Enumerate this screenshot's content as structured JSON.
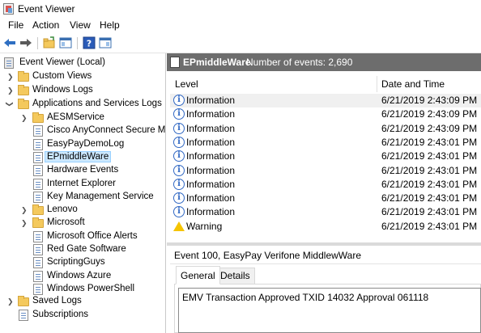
{
  "window": {
    "title": "Event Viewer"
  },
  "menu": [
    "File",
    "Action",
    "View",
    "Help"
  ],
  "toolbar": {
    "icons": [
      "back-arrow-icon",
      "forward-arrow-icon",
      "open-saved-log-icon",
      "show-hide-tree-icon",
      "help-icon",
      "show-hide-action-pane-icon"
    ]
  },
  "tree": {
    "root": "Event Viewer (Local)",
    "custom_views": "Custom Views",
    "windows_logs": "Windows Logs",
    "apps_services": "Applications and Services Logs",
    "children": [
      {
        "label": "AESMService",
        "icon": "folder",
        "expandable": true
      },
      {
        "label": "Cisco AnyConnect Secure Mobility Client",
        "icon": "log",
        "expandable": false
      },
      {
        "label": "EasyPayDemoLog",
        "icon": "log",
        "expandable": false
      },
      {
        "label": "EPmiddleWare",
        "icon": "log",
        "expandable": false,
        "selected": true
      },
      {
        "label": "Hardware Events",
        "icon": "log",
        "expandable": false
      },
      {
        "label": "Internet Explorer",
        "icon": "log",
        "expandable": false
      },
      {
        "label": "Key Management Service",
        "icon": "log",
        "expandable": false
      },
      {
        "label": "Lenovo",
        "icon": "folder",
        "expandable": true
      },
      {
        "label": "Microsoft",
        "icon": "folder",
        "expandable": true
      },
      {
        "label": "Microsoft Office Alerts",
        "icon": "log",
        "expandable": false
      },
      {
        "label": "Red Gate Software",
        "icon": "log",
        "expandable": false
      },
      {
        "label": "ScriptingGuys",
        "icon": "log",
        "expandable": false
      },
      {
        "label": "Windows Azure",
        "icon": "log",
        "expandable": false
      },
      {
        "label": "Windows PowerShell",
        "icon": "log",
        "expandable": false
      }
    ],
    "saved_logs": "Saved Logs",
    "subscriptions": "Subscriptions"
  },
  "content": {
    "log_name": "EPmiddleWare",
    "event_count": "Number of events: 2,690",
    "columns": {
      "level": "Level",
      "date": "Date and Time"
    },
    "events": [
      {
        "level": "Information",
        "date": "6/21/2019 2:43:09 PM",
        "icon": "info"
      },
      {
        "level": "Information",
        "date": "6/21/2019 2:43:09 PM",
        "icon": "info"
      },
      {
        "level": "Information",
        "date": "6/21/2019 2:43:09 PM",
        "icon": "info"
      },
      {
        "level": "Information",
        "date": "6/21/2019 2:43:01 PM",
        "icon": "info"
      },
      {
        "level": "Information",
        "date": "6/21/2019 2:43:01 PM",
        "icon": "info"
      },
      {
        "level": "Information",
        "date": "6/21/2019 2:43:01 PM",
        "icon": "info"
      },
      {
        "level": "Information",
        "date": "6/21/2019 2:43:01 PM",
        "icon": "info"
      },
      {
        "level": "Information",
        "date": "6/21/2019 2:43:01 PM",
        "icon": "info"
      },
      {
        "level": "Information",
        "date": "6/21/2019 2:43:01 PM",
        "icon": "info"
      },
      {
        "level": "Warning",
        "date": "6/21/2019 2:43:01 PM",
        "icon": "warning"
      }
    ]
  },
  "detail": {
    "title": "Event 100, EasyPay Verifone MiddlewWare",
    "tabs": [
      "General",
      "Details"
    ],
    "message": "EMV Transaction Approved TXID 14032 Approval 061118"
  }
}
